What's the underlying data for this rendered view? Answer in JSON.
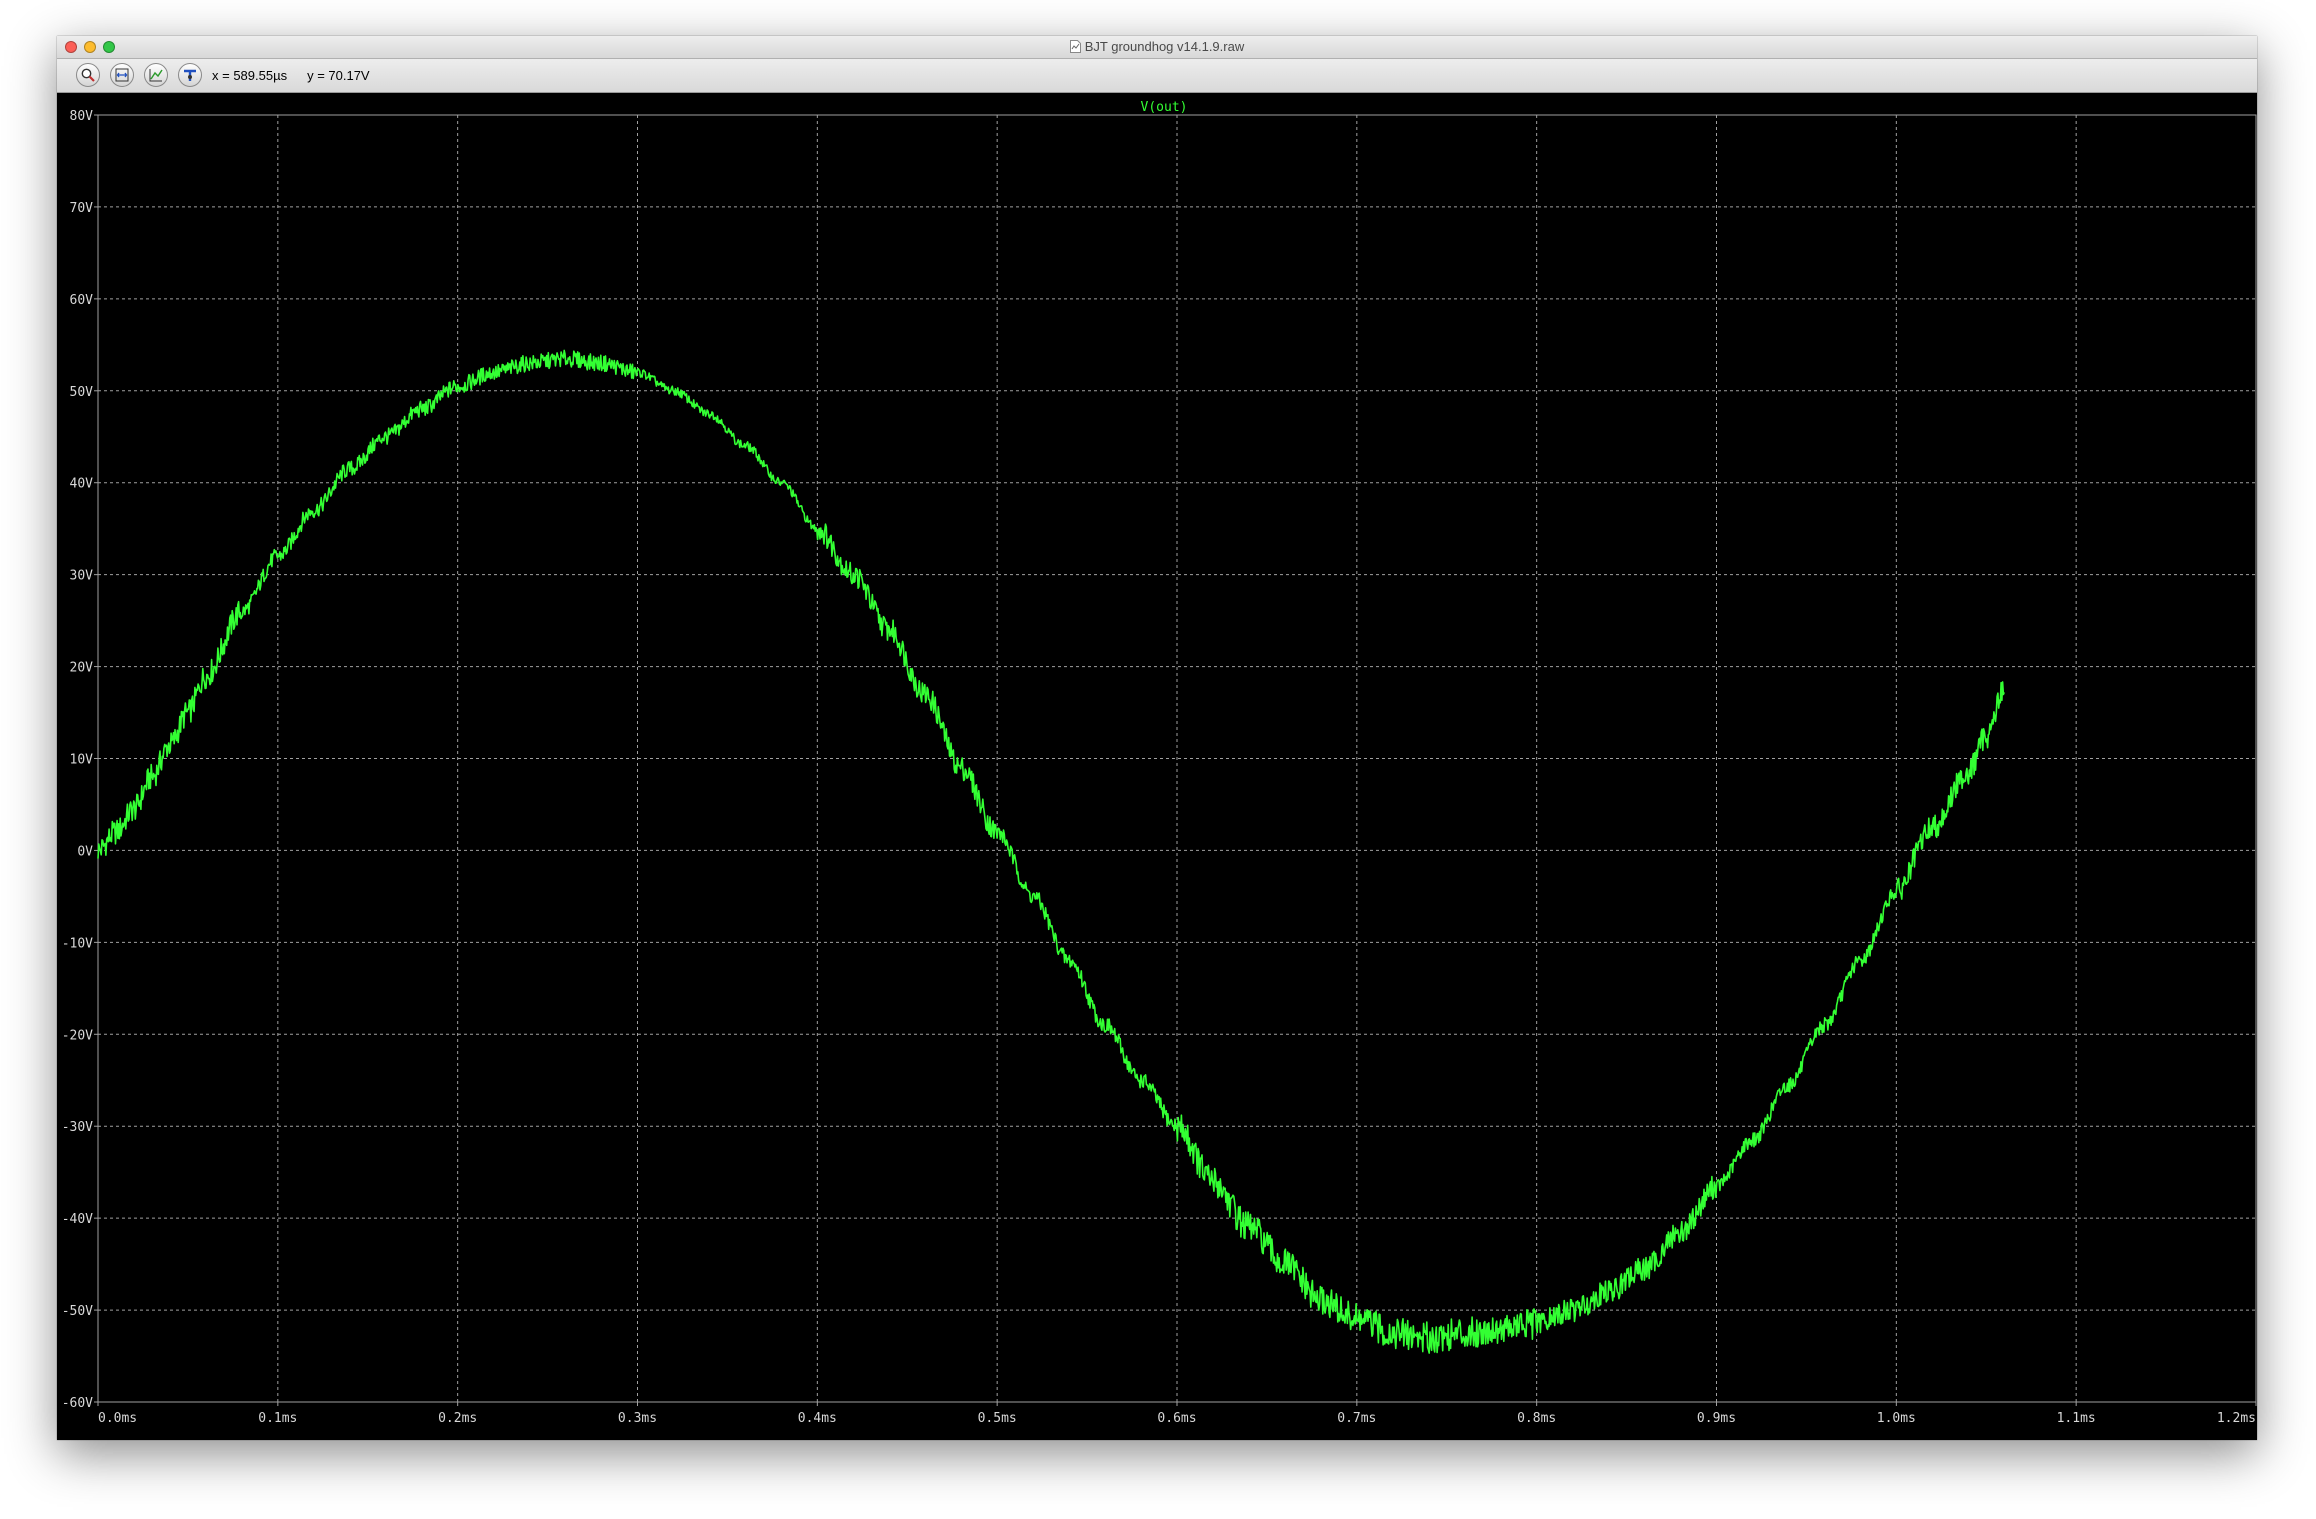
{
  "window": {
    "title": "BJT groundhog v14.1.9.raw"
  },
  "toolbar": {
    "cursor_x": "x = 589.55µs",
    "cursor_y": "y = 70.17V",
    "icons": [
      "zoom-icon",
      "autorange-icon",
      "fit-icon",
      "pan-icon"
    ]
  },
  "colors": {
    "trace": "#33ff33",
    "background": "#000000",
    "grid": "#a0a0a0",
    "axis_text": "#d8d8d8"
  },
  "chart_data": {
    "type": "line",
    "title": "V(out)",
    "xlabel": "",
    "ylabel": "",
    "xlim": [
      0,
      1.2
    ],
    "ylim": [
      -60,
      80
    ],
    "x_unit": "ms",
    "y_unit": "V",
    "xticks": [
      "0.0ms",
      "0.1ms",
      "0.2ms",
      "0.3ms",
      "0.4ms",
      "0.5ms",
      "0.6ms",
      "0.7ms",
      "0.8ms",
      "0.9ms",
      "1.0ms",
      "1.1ms",
      "1.2ms"
    ],
    "yticks": [
      "80V",
      "70V",
      "60V",
      "50V",
      "40V",
      "30V",
      "20V",
      "10V",
      "0V",
      "-10V",
      "-20V",
      "-30V",
      "-40V",
      "-50V",
      "-60V"
    ],
    "grid": true,
    "series": [
      {
        "name": "V(out)",
        "x": [
          0,
          0.01,
          0.02,
          0.03,
          0.04,
          0.05,
          0.06,
          0.08,
          0.1,
          0.12,
          0.14,
          0.16,
          0.18,
          0.2,
          0.22,
          0.24,
          0.26,
          0.28,
          0.3,
          0.32,
          0.34,
          0.36,
          0.38,
          0.4,
          0.42,
          0.44,
          0.46,
          0.48,
          0.5,
          0.52,
          0.54,
          0.56,
          0.58,
          0.6,
          0.62,
          0.64,
          0.66,
          0.68,
          0.7,
          0.72,
          0.74,
          0.76,
          0.78,
          0.8,
          0.82,
          0.84,
          0.86,
          0.88,
          0.9,
          0.92,
          0.94,
          0.96,
          0.98,
          1.0,
          1.02,
          1.04,
          1.05,
          1.06
        ],
        "y": [
          0,
          2,
          4.5,
          8,
          11.5,
          15,
          19,
          26,
          32,
          37,
          41.5,
          45,
          48,
          50.5,
          52,
          53,
          53.5,
          53,
          52,
          50,
          47.5,
          44,
          40,
          35,
          30,
          24,
          17,
          9,
          2,
          -5,
          -12,
          -19,
          -25,
          -30,
          -36,
          -41,
          -45,
          -49,
          -51,
          -52.5,
          -53,
          -52.5,
          -52,
          -51.5,
          -50,
          -48,
          -45.5,
          -41.5,
          -36.5,
          -31.5,
          -25.5,
          -19,
          -12,
          -4.5,
          2.5,
          8.5,
          12.5,
          17.5
        ]
      }
    ]
  }
}
